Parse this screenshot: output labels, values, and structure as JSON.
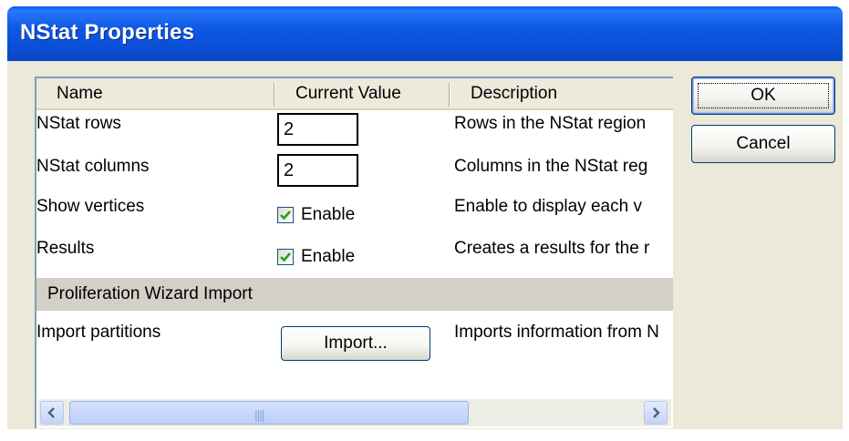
{
  "window": {
    "title": "NStat Properties"
  },
  "grid": {
    "columns": [
      "Name",
      "Current Value",
      "Description"
    ],
    "rows": [
      {
        "name": "NStat rows",
        "value": "2",
        "description": "Rows in the NStat region"
      },
      {
        "name": "NStat columns",
        "value": "2",
        "description": "Columns in the NStat reg"
      },
      {
        "name": "Show vertices",
        "checkbox_label": "Enable",
        "checked": true,
        "description": "Enable to display each v"
      },
      {
        "name": "Results",
        "checkbox_label": "Enable",
        "checked": true,
        "description": "Creates a results for the r"
      }
    ],
    "section": "Proliferation Wizard Import",
    "import_row": {
      "name": "Import partitions",
      "button": "Import...",
      "description": "Imports information from N"
    }
  },
  "buttons": {
    "ok": "OK",
    "cancel": "Cancel"
  },
  "colors": {
    "titlebar": "#0a50d8",
    "face": "#ece9d8",
    "check": "#21a121"
  }
}
